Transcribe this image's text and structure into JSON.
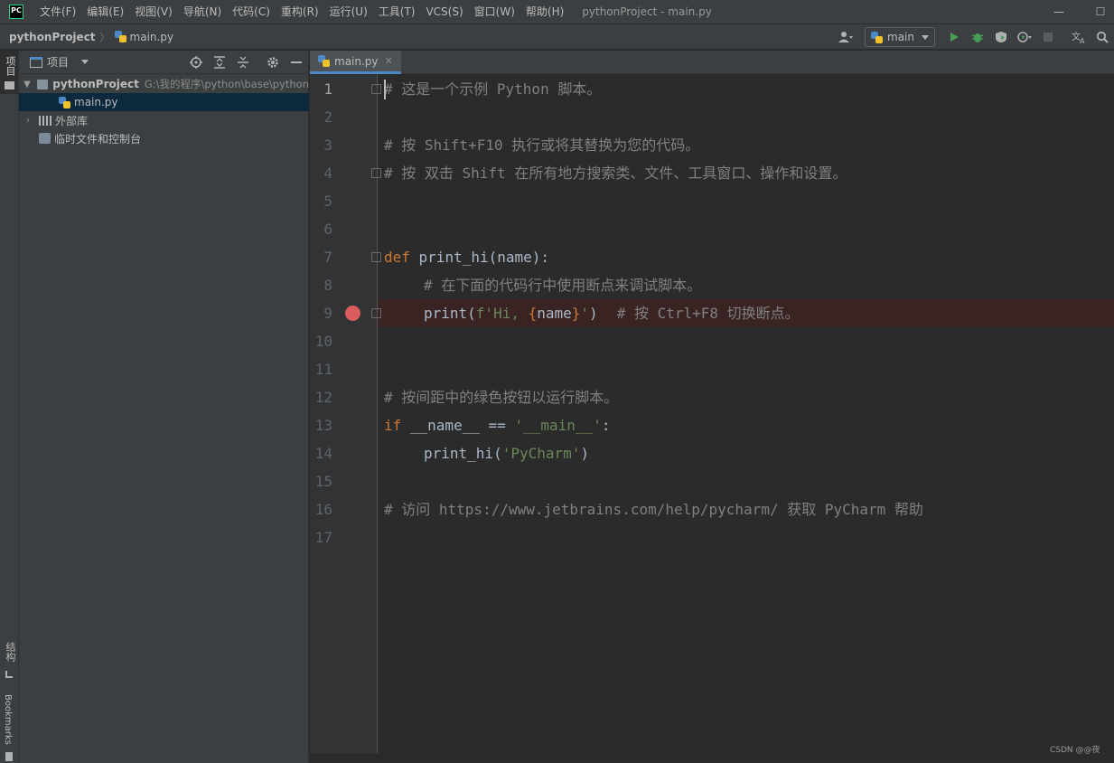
{
  "app_logo": "PC",
  "menu": [
    "文件(F)",
    "编辑(E)",
    "视图(V)",
    "导航(N)",
    "代码(C)",
    "重构(R)",
    "运行(U)",
    "工具(T)",
    "VCS(S)",
    "窗口(W)",
    "帮助(H)"
  ],
  "window_title": "pythonProject - main.py",
  "window_controls": {
    "minimize": "—",
    "maximize": "☐"
  },
  "breadcrumb": {
    "project": "pythonProject",
    "separator": "〉",
    "file": "main.py"
  },
  "toolbar": {
    "run_config": "main",
    "icons": [
      "account-icon",
      "python-icon",
      "run-icon",
      "debug-icon",
      "coverage-icon",
      "profile-icon",
      "stop-icon",
      "translate-icon",
      "search-icon"
    ]
  },
  "left_strip": {
    "top": "项目",
    "structure": "结构",
    "bookmarks": "Bookmarks"
  },
  "project_panel": {
    "title": "项目",
    "tree": {
      "root_name": "pythonProject",
      "root_path": "G:\\我的程序\\python\\base\\python",
      "file": "main.py",
      "external": "外部库",
      "scratches": "临时文件和控制台"
    }
  },
  "editor": {
    "tab": "main.py",
    "lines": {
      "l1": "# 这是一个示例 Python 脚本。",
      "l3": "# 按 Shift+F10 执行或将其替换为您的代码。",
      "l4": "# 按 双击 Shift 在所有地方搜索类、文件、工具窗口、操作和设置。",
      "l7_kw": "def",
      "l7_rest": " print_hi(name):",
      "l8": "# 在下面的代码行中使用断点来调试脚本。",
      "l9_call": "print(",
      "l9_str1": "f'Hi, ",
      "l9_fmt_open": "{",
      "l9_name": "name",
      "l9_fmt_close": "}",
      "l9_str2": "'",
      "l9_close": ")",
      "l9_comment": "# 按 Ctrl+F8 切换断点。",
      "l12": "# 按间距中的绿色按钮以运行脚本。",
      "l13_kw": "if",
      "l13_mid": " __name__ == ",
      "l13_str": "'__main__'",
      "l13_end": ":",
      "l14_call": "print_hi(",
      "l14_str": "'PyCharm'",
      "l14_close": ")",
      "l16": "# 访问 https://www.jetbrains.com/help/pycharm/ 获取 PyCharm 帮助"
    },
    "line_numbers": [
      "1",
      "2",
      "3",
      "4",
      "5",
      "6",
      "7",
      "8",
      "9",
      "10",
      "11",
      "12",
      "13",
      "14",
      "15",
      "16",
      "17"
    ]
  },
  "watermark": "CSDN @@夜",
  "colors": {
    "background": "#2b2b2b",
    "keyword": "#cc7832",
    "string": "#6a8759",
    "comment": "#808080",
    "breakpoint": "#db5c5c",
    "selection": "#0d293e"
  }
}
